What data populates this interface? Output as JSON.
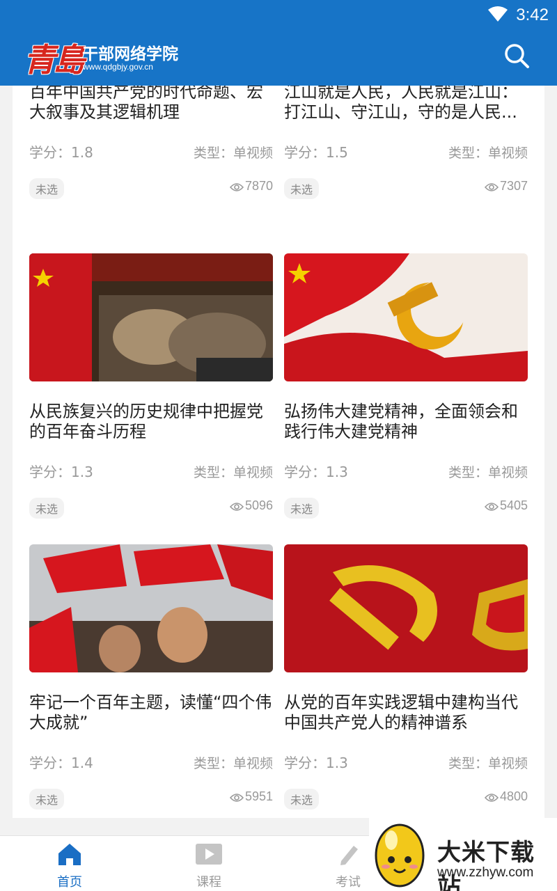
{
  "status_bar": {
    "time": "3:42"
  },
  "header": {
    "logo_mark": "青島",
    "title": "干部网络学院",
    "url": "www.qdgbjy.gov.cn",
    "search_icon": "search-icon"
  },
  "courses": [
    {
      "title": "百年中国共产党的时代命题、宏大叙事及其逻辑机理",
      "credit": "学分：1.8",
      "type": "类型：单视频",
      "status": "未选",
      "views": "7870"
    },
    {
      "title": "江山就是人民，人民就是江山：打江山、守江山，守的是人民...",
      "credit": "学分：1.5",
      "type": "类型：单视频",
      "status": "未选",
      "views": "7307"
    },
    {
      "title": "从民族复兴的历史规律中把握党的百年奋斗历程",
      "credit": "学分：1.3",
      "type": "类型：单视频",
      "status": "未选",
      "views": "5096"
    },
    {
      "title": "弘扬伟大建党精神，全面领会和践行伟大建党精神",
      "credit": "学分：1.3",
      "type": "类型：单视频",
      "status": "未选",
      "views": "5405"
    },
    {
      "title": "牢记一个百年主题，读懂“四个伟大成就”",
      "credit": "学分：1.4",
      "type": "类型：单视频",
      "status": "未选",
      "views": "5951"
    },
    {
      "title": "从党的百年实践逻辑中建构当代中国共产党人的精神谱系",
      "credit": "学分：1.3",
      "type": "类型：单视频",
      "status": "未选",
      "views": "4800"
    }
  ],
  "nav": {
    "home": "首页",
    "course": "课程",
    "exam": "考试"
  },
  "watermark": {
    "title": "大米下载站",
    "url": "www.zzhyw.com"
  },
  "colors": {
    "brand_blue": "#1774c7",
    "active_nav": "#1a6ec4",
    "muted_text": "#999999"
  }
}
